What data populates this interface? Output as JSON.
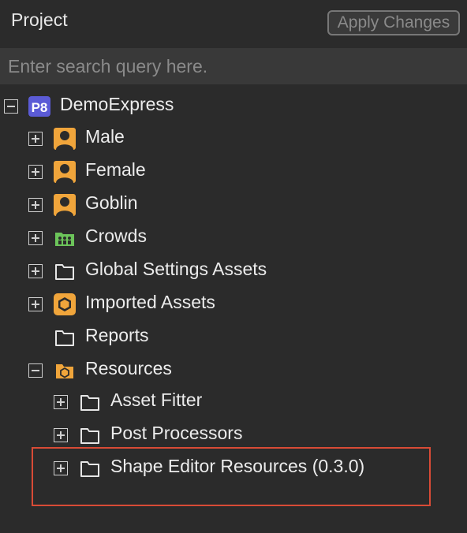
{
  "header": {
    "title": "Project",
    "apply_label": "Apply Changes"
  },
  "search": {
    "placeholder": "Enter search query here.",
    "value": ""
  },
  "tree": {
    "root": {
      "label": "DemoExpress",
      "icon": "p8-project-icon",
      "badge": "P8",
      "expanded": true
    },
    "items": [
      {
        "label": "Male",
        "icon": "character-icon",
        "expanded": false
      },
      {
        "label": "Female",
        "icon": "character-icon",
        "expanded": false
      },
      {
        "label": "Goblin",
        "icon": "character-icon",
        "expanded": false
      },
      {
        "label": "Crowds",
        "icon": "crowd-folder-icon",
        "expanded": false
      },
      {
        "label": "Global Settings Assets",
        "icon": "folder-icon",
        "expanded": false
      },
      {
        "label": "Imported Assets",
        "icon": "hexagon-asset-icon",
        "expanded": false
      },
      {
        "label": "Reports",
        "icon": "folder-icon"
      },
      {
        "label": "Resources",
        "icon": "resources-folder-icon",
        "expanded": true
      },
      {
        "label": "Asset Fitter",
        "icon": "folder-icon",
        "expanded": false
      },
      {
        "label": "Post Processors",
        "icon": "folder-icon",
        "expanded": false
      },
      {
        "label": "Shape Editor Resources (0.3.0)",
        "icon": "folder-icon",
        "expanded": false
      }
    ]
  },
  "colors": {
    "background": "#2b2b2b",
    "search_bg": "#393939",
    "accent_orange": "#f0a53b",
    "p8_badge": "#5b5bd6",
    "crowd_green": "#6cc45a",
    "highlight": "#d94b36"
  }
}
